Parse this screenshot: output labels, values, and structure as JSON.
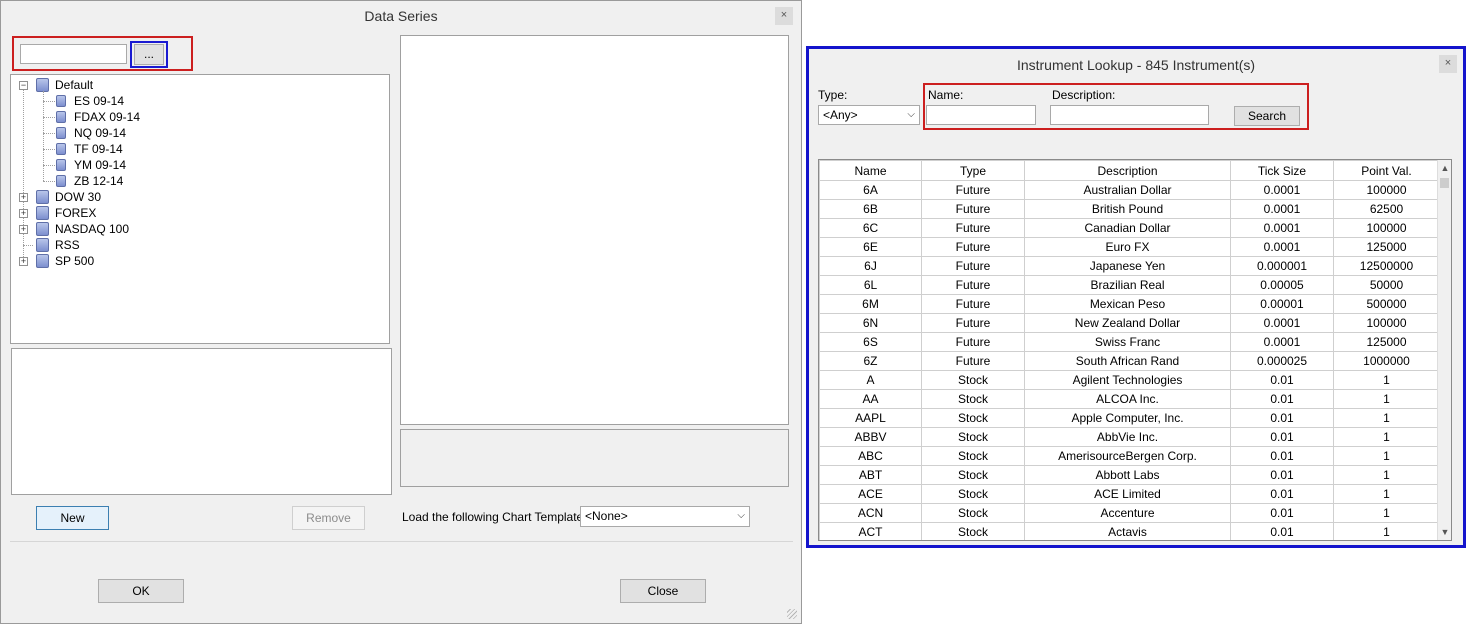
{
  "data_series": {
    "title": "Data Series",
    "close_glyph": "×",
    "search_value": "",
    "browse_label": "...",
    "tree": [
      {
        "label": "Default",
        "expander": "−",
        "children": [
          "ES 09-14",
          "FDAX 09-14",
          "NQ 09-14",
          "TF 09-14",
          "YM 09-14",
          "ZB 12-14"
        ]
      },
      {
        "label": "DOW 30",
        "expander": "+"
      },
      {
        "label": "FOREX",
        "expander": "+"
      },
      {
        "label": "NASDAQ 100",
        "expander": "+"
      },
      {
        "label": "RSS",
        "expander": ""
      },
      {
        "label": "SP 500",
        "expander": "+"
      }
    ],
    "new_label": "New",
    "remove_label": "Remove",
    "template_label": "Load the following Chart Template:",
    "template_value": "<None>",
    "ok_label": "OK",
    "close_label": "Close"
  },
  "instrument_lookup": {
    "title": "Instrument Lookup - 845 Instrument(s)",
    "close_glyph": "×",
    "type_label": "Type:",
    "type_value": "<Any>",
    "name_label": "Name:",
    "name_value": "",
    "description_label": "Description:",
    "description_value": "",
    "search_label": "Search",
    "columns": [
      "Name",
      "Type",
      "Description",
      "Tick Size",
      "Point Val."
    ],
    "rows": [
      [
        "6A",
        "Future",
        "Australian Dollar",
        "0.0001",
        "100000"
      ],
      [
        "6B",
        "Future",
        "British Pound",
        "0.0001",
        "62500"
      ],
      [
        "6C",
        "Future",
        "Canadian Dollar",
        "0.0001",
        "100000"
      ],
      [
        "6E",
        "Future",
        "Euro FX",
        "0.0001",
        "125000"
      ],
      [
        "6J",
        "Future",
        "Japanese Yen",
        "0.000001",
        "12500000"
      ],
      [
        "6L",
        "Future",
        "Brazilian Real",
        "0.00005",
        "50000"
      ],
      [
        "6M",
        "Future",
        "Mexican Peso",
        "0.00001",
        "500000"
      ],
      [
        "6N",
        "Future",
        "New Zealand Dollar",
        "0.0001",
        "100000"
      ],
      [
        "6S",
        "Future",
        "Swiss Franc",
        "0.0001",
        "125000"
      ],
      [
        "6Z",
        "Future",
        "South African Rand",
        "0.000025",
        "1000000"
      ],
      [
        "A",
        "Stock",
        "Agilent Technologies",
        "0.01",
        "1"
      ],
      [
        "AA",
        "Stock",
        "ALCOA Inc.",
        "0.01",
        "1"
      ],
      [
        "AAPL",
        "Stock",
        "Apple Computer, Inc.",
        "0.01",
        "1"
      ],
      [
        "ABBV",
        "Stock",
        "AbbVie Inc.",
        "0.01",
        "1"
      ],
      [
        "ABC",
        "Stock",
        "AmerisourceBergen Corp.",
        "0.01",
        "1"
      ],
      [
        "ABT",
        "Stock",
        "Abbott Labs",
        "0.01",
        "1"
      ],
      [
        "ACE",
        "Stock",
        "ACE Limited",
        "0.01",
        "1"
      ],
      [
        "ACN",
        "Stock",
        "Accenture",
        "0.01",
        "1"
      ],
      [
        "ACT",
        "Stock",
        "Actavis",
        "0.01",
        "1"
      ]
    ]
  },
  "colors": {
    "highlight_red": "#cc1f1f",
    "highlight_blue": "#1a1ad1",
    "window_bg": "#f0f0f0"
  }
}
